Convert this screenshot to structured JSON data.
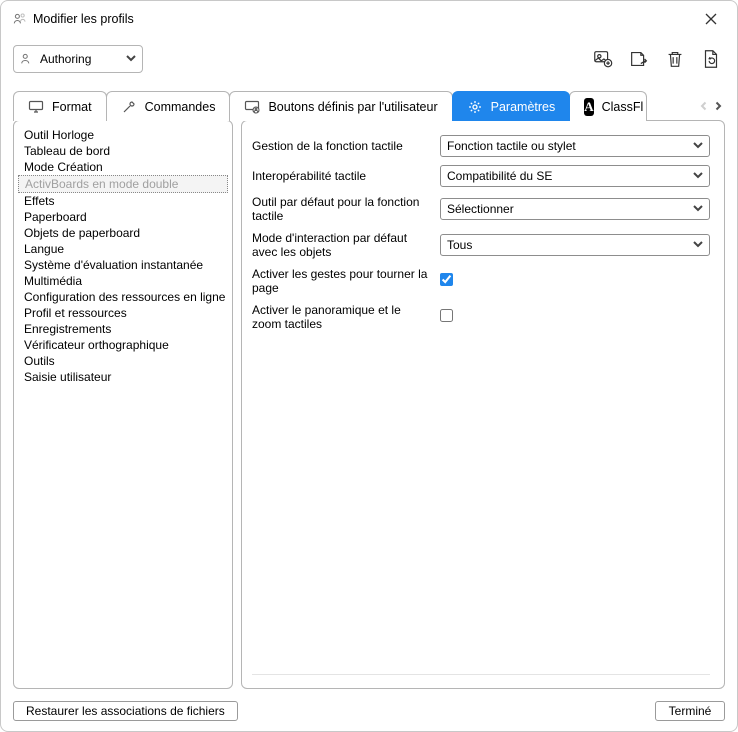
{
  "window": {
    "title": "Modifier les profils"
  },
  "profile_combo": {
    "value": "Authoring"
  },
  "tabs": {
    "format": "Format",
    "commandes": "Commandes",
    "boutons": "Boutons définis par l'utilisateur",
    "parametres": "Paramètres",
    "classflow": "ClassFl"
  },
  "sidebar": {
    "items": [
      "Outil Horloge",
      "Tableau de bord",
      "Mode Création",
      "ActivBoards en mode double",
      "Effets",
      "Paperboard",
      "Objets de paperboard",
      "Langue",
      "Système d'évaluation instantanée",
      "Multimédia",
      "Configuration des ressources en ligne",
      "Profil et ressources",
      "Enregistrements",
      "Vérificateur orthographique",
      "Outils",
      "Saisie utilisateur"
    ],
    "selected_index": 3
  },
  "form": {
    "rows": [
      {
        "label": "Gestion de la fonction tactile",
        "type": "combo",
        "value": "Fonction tactile ou stylet"
      },
      {
        "label": "Interopérabilité tactile",
        "type": "combo",
        "value": "Compatibilité du SE"
      },
      {
        "label": "Outil par défaut pour la fonction tactile",
        "type": "combo",
        "value": "Sélectionner"
      },
      {
        "label": "Mode d'interaction par défaut avec les objets",
        "type": "combo",
        "value": "Tous"
      },
      {
        "label": "Activer les gestes pour tourner la page",
        "type": "checkbox",
        "checked": true
      },
      {
        "label": "Activer le panoramique et le zoom tactiles",
        "type": "checkbox",
        "checked": false
      }
    ]
  },
  "buttons": {
    "restore": "Restaurer les associations de fichiers",
    "done": "Terminé"
  }
}
